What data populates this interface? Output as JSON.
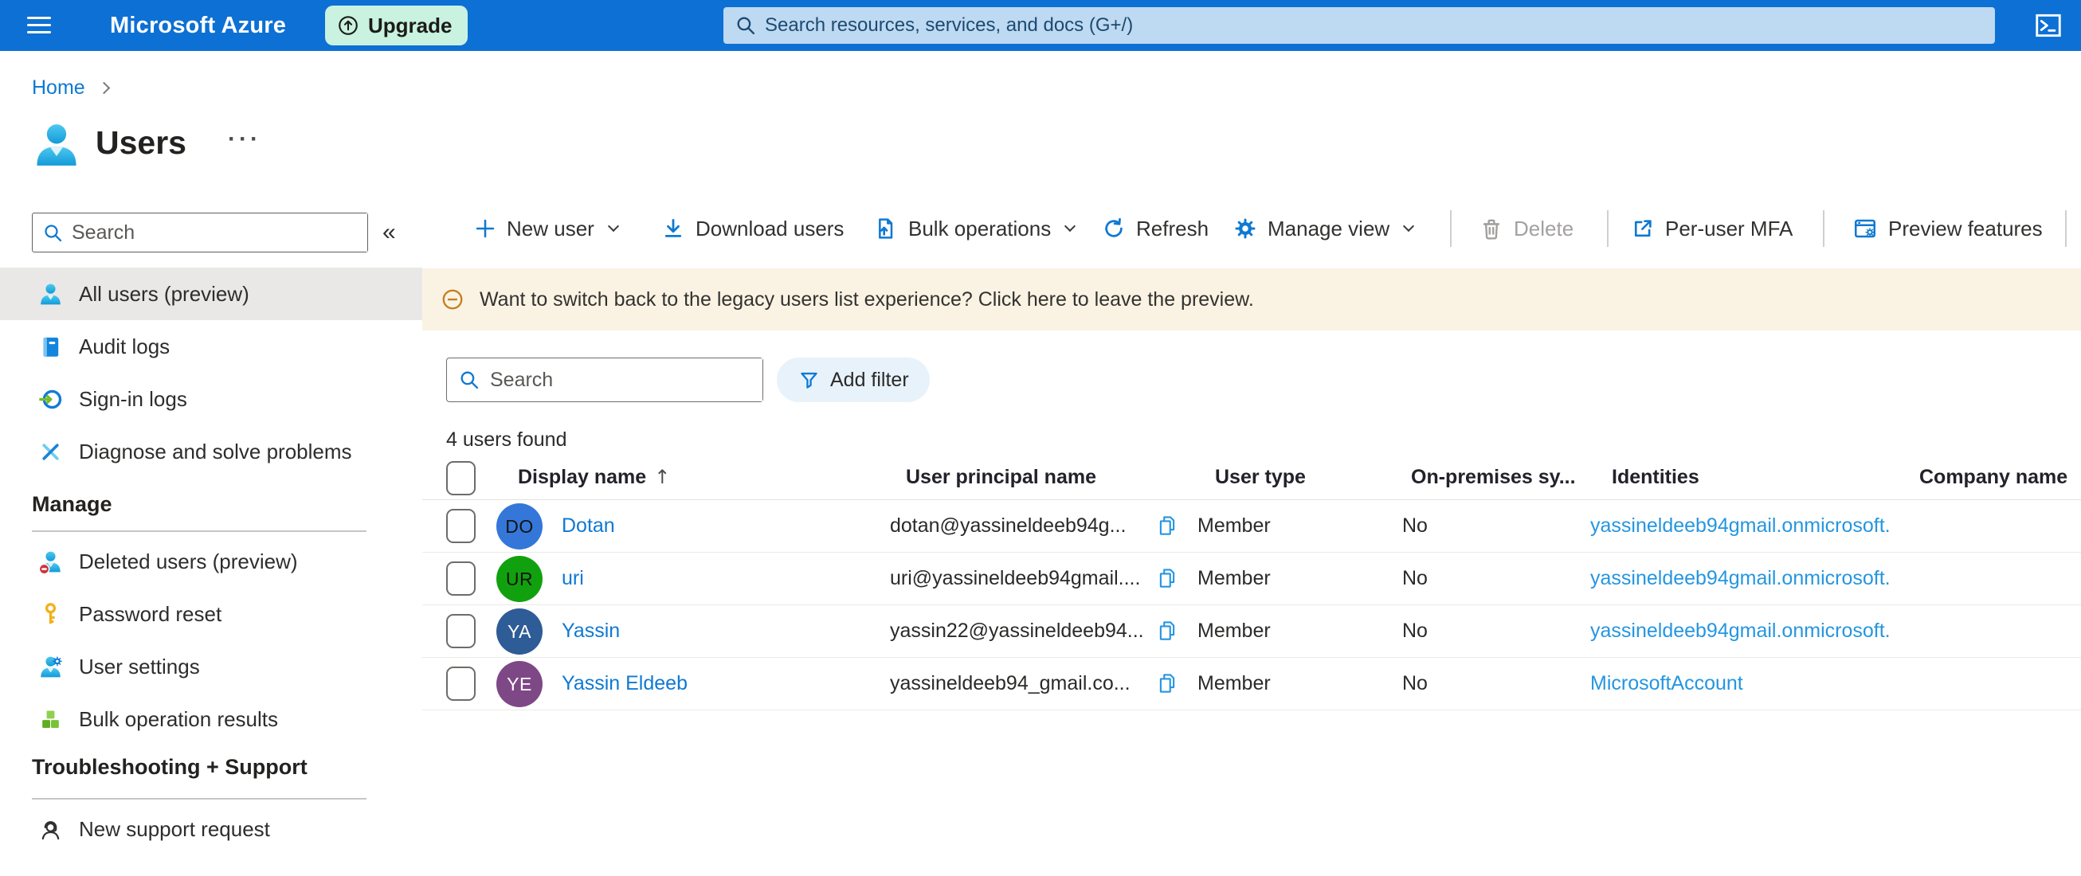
{
  "topbar": {
    "brand": "Microsoft Azure",
    "upgrade_label": "Upgrade",
    "search_placeholder": "Search resources, services, and docs (G+/)",
    "colors": {
      "bar": "#0d70d4",
      "upgrade_bg": "#c9f2e0",
      "search_bg": "#bed9f2",
      "accent": "#0e79d3"
    }
  },
  "breadcrumb": {
    "home_label": "Home"
  },
  "page": {
    "title": "Users",
    "more_glyph": "···"
  },
  "sidebar": {
    "search_placeholder": "Search",
    "collapse_glyph": "«",
    "top_items": [
      {
        "label": "All users (preview)"
      },
      {
        "label": "Audit logs"
      },
      {
        "label": "Sign-in logs"
      },
      {
        "label": "Diagnose and solve problems"
      }
    ],
    "manage_header": "Manage",
    "manage_items": [
      {
        "label": "Deleted users (preview)"
      },
      {
        "label": "Password reset"
      },
      {
        "label": "User settings"
      },
      {
        "label": "Bulk operation results"
      }
    ],
    "support_header": "Troubleshooting + Support",
    "support_items": [
      {
        "label": "New support request"
      }
    ]
  },
  "toolbar": {
    "new_user": "New user",
    "download_users": "Download users",
    "bulk_operations": "Bulk operations",
    "refresh": "Refresh",
    "manage_view": "Manage view",
    "delete": "Delete",
    "per_user_mfa": "Per-user MFA",
    "preview_features": "Preview features"
  },
  "banner": {
    "text": "Want to switch back to the legacy users list experience? Click here to leave the preview.",
    "bg_color": "#faf3e4",
    "icon_color": "#c57f1f"
  },
  "filters": {
    "search_placeholder": "Search",
    "add_filter_label": "Add filter"
  },
  "results_count": "4 users found",
  "users_table": {
    "headers": {
      "display_name": "Display name",
      "sort_arrow": "↑",
      "user_principal_name": "User principal name",
      "user_type": "User type",
      "on_premises": "On-premises sy...",
      "identities": "Identities",
      "company_name": "Company name"
    },
    "rows": [
      {
        "initials": "DO",
        "avatar_style": "background:#3477d9;color:#14130f",
        "display_name": "Dotan",
        "upn": "dotan@yassineldeeb94g...",
        "user_type": "Member",
        "on_premises_sync": "No",
        "identities": "yassineldeeb94gmail.onmicrosoft."
      },
      {
        "initials": "UR",
        "avatar_style": "background:#12a10e;color:#14130f",
        "display_name": "uri",
        "upn": "uri@yassineldeeb94gmail....",
        "user_type": "Member",
        "on_premises_sync": "No",
        "identities": "yassineldeeb94gmail.onmicrosoft."
      },
      {
        "initials": "YA",
        "avatar_style": "background:#2d5c97;color:#ffffff",
        "display_name": "Yassin",
        "upn": "yassin22@yassineldeeb94...",
        "user_type": "Member",
        "on_premises_sync": "No",
        "identities": "yassineldeeb94gmail.onmicrosoft."
      },
      {
        "initials": "YE",
        "avatar_style": "background:#7e4886;color:#ffffff",
        "display_name": "Yassin Eldeeb",
        "upn": "yassineldeeb94_gmail.co...",
        "user_type": "Member",
        "on_premises_sync": "No",
        "identities": "MicrosoftAccount"
      }
    ]
  }
}
